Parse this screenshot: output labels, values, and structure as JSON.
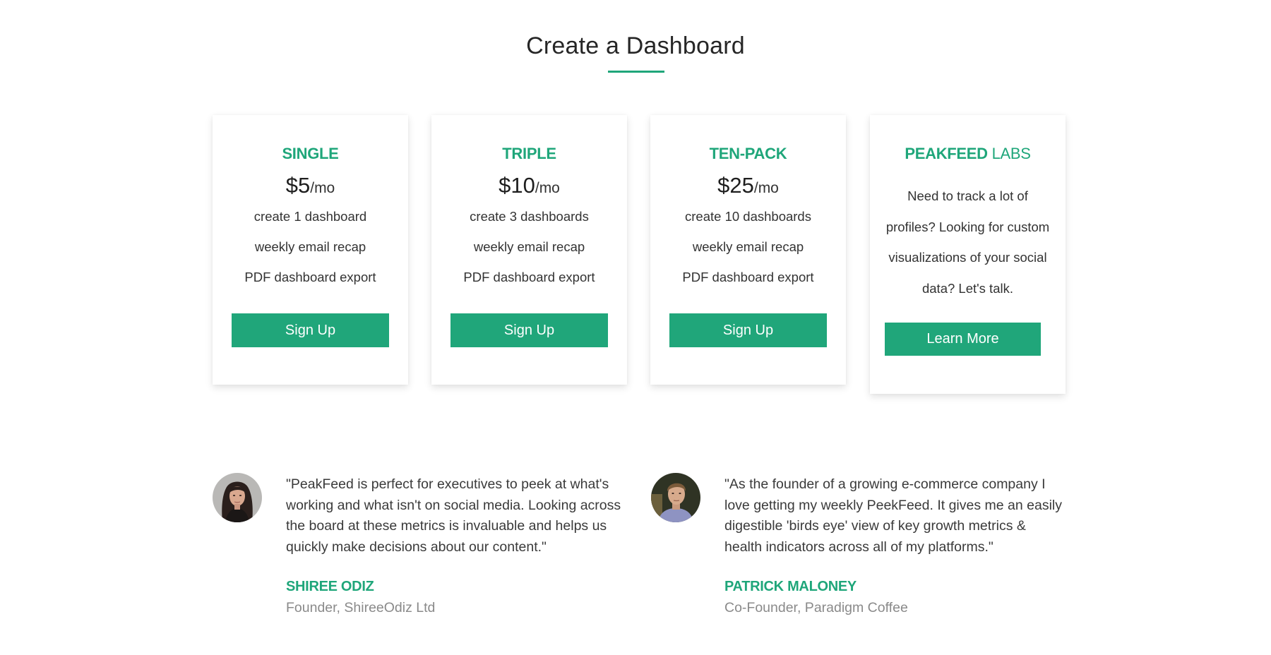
{
  "header": {
    "title": "Create a Dashboard"
  },
  "theme": {
    "accent": "#1fa67a",
    "button_bg": "#20a67a",
    "button_text": "#ffffff"
  },
  "plans": [
    {
      "name": "SINGLE",
      "price": "$5",
      "period": "/mo",
      "features": [
        "create 1 dashboard",
        "weekly email recap",
        "PDF dashboard export"
      ],
      "cta_label": "Sign Up"
    },
    {
      "name": "TRIPLE",
      "price": "$10",
      "period": "/mo",
      "features": [
        "create 3 dashboards",
        "weekly email recap",
        "PDF dashboard export"
      ],
      "cta_label": "Sign Up"
    },
    {
      "name": "TEN-PACK",
      "price": "$25",
      "period": "/mo",
      "features": [
        "create 10 dashboards",
        "weekly email recap",
        "PDF dashboard export"
      ],
      "cta_label": "Sign Up"
    }
  ],
  "labs": {
    "name_bold": "PEAKFEED",
    "name_light": "LABS",
    "description": "Need to track a lot of profiles? Looking for custom visualizations of your social data? Let's talk.",
    "cta_label": "Learn More"
  },
  "testimonials": [
    {
      "avatar": "woman-portrait-avatar",
      "quote": "\"PeakFeed is perfect for executives to peek at what's working and what isn't on social media. Looking across the board at these metrics is invaluable and helps us quickly make decisions about our content.\"",
      "name": "SHIREE ODIZ",
      "role": "Founder, ShireeOdiz Ltd"
    },
    {
      "avatar": "man-portrait-avatar",
      "quote": "\"As the founder of a growing e-commerce company I love getting my weekly PeekFeed. It gives me an easily digestible 'birds eye' view of key growth metrics & health indicators across all of my platforms.\"",
      "name": "PATRICK MALONEY",
      "role": "Co-Founder, Paradigm Coffee"
    }
  ]
}
